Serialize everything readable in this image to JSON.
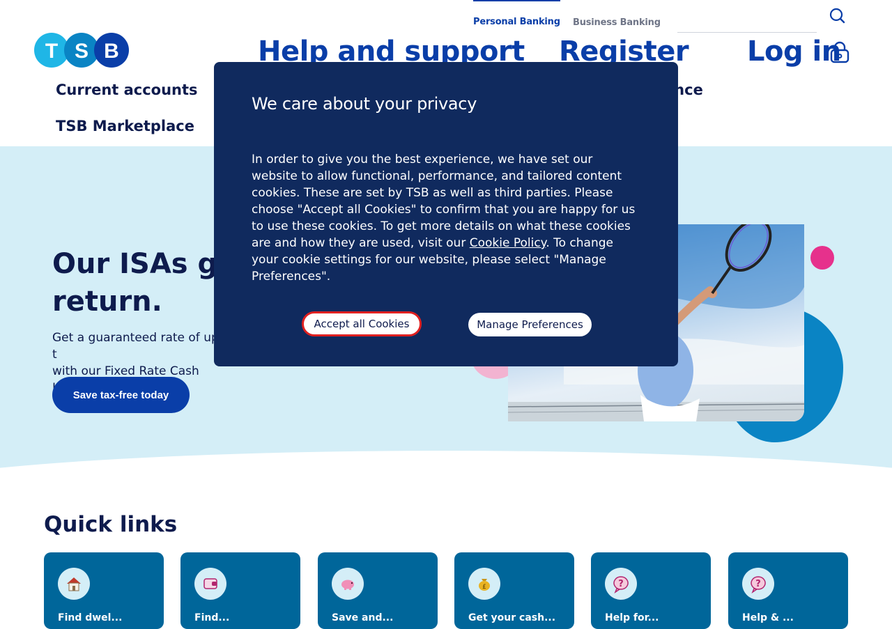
{
  "header": {
    "tabs": {
      "personal": "Personal Banking",
      "business": "Business Banking"
    },
    "logo_text": "TSB",
    "nav": {
      "help": "Help and support",
      "register": "Register",
      "login": "Log in"
    },
    "sub_nav": {
      "current_accounts": "Current accounts",
      "marketplace": "TSB Marketplace",
      "insurance_fragment": "ance"
    }
  },
  "hero": {
    "title_visible_1": "Our ISAs giv",
    "title_visible_2": "return.",
    "sub_visible_1": "Get a guaranteed rate of up t",
    "sub_visible_2": "with our Fixed Rate Cash ISAs",
    "cta": "Save tax-free today"
  },
  "quick_links": {
    "title": "Quick links",
    "cards": [
      {
        "icon": "house-icon",
        "label": "Find dwel..."
      },
      {
        "icon": "wallet-icon",
        "label": "Find..."
      },
      {
        "icon": "piggy-bank-icon",
        "label": "Save and..."
      },
      {
        "icon": "money-bag-icon",
        "label": "Get your cash..."
      },
      {
        "icon": "question-bubble-icon",
        "label": "Help for..."
      },
      {
        "icon": "question-bubble-icon",
        "label": "Help & ..."
      }
    ]
  },
  "cookie_modal": {
    "title": "We care about your privacy",
    "body_before_link": "In order to give you the best experience, we have set our website to allow functional, performance, and tailored content cookies. These are set by TSB as well as third parties. Please choose \"Accept all Cookies\" to confirm that you are happy for us to use these cookies. To get more details on what these cookies are and how they are used, visit our ",
    "link": "Cookie Policy",
    "body_after_link": ". To change your cookie settings for our website, please select \"Manage Preferences\".",
    "accept": "Accept all Cookies",
    "manage": "Manage Preferences"
  },
  "colors": {
    "brand_blue": "#0a3ea8",
    "navy": "#0e1b4d",
    "modal_bg": "#102a5e",
    "hero_bg": "#d4eef7",
    "card_blue": "#00669a",
    "pink": "#e6318c",
    "focus_red": "#e02020"
  }
}
